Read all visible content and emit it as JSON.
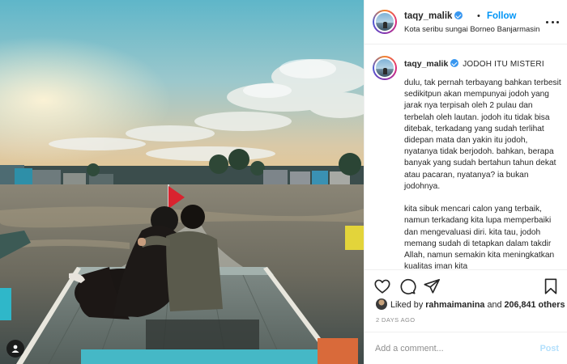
{
  "post": {
    "username": "taqy_malik",
    "follow_label": "Follow",
    "separator": "•",
    "location": "Kota seribu sungai Borneo Banjarmasin",
    "caption_title": "JODOH ITU MISTERI",
    "caption_body": "dulu, tak pernah terbayang bahkan terbesit sedikitpun akan mempunyai jodoh yang jarak nya terpisah oleh 2 pulau dan terbelah oleh lautan. jodoh itu tidak bisa ditebak, terkadang yang sudah terlihat didepan mata dan yakin itu jodoh, nyatanya tidak berjodoh. bahkan, berapa banyak yang sudah bertahun tahun dekat atau pacaran, nyatanya? ia bukan jodohnya.\n\nkita sibuk mencari calon yang terbaik, namun terkadang kita lupa memperbaiki dan mengevaluasi diri. kita tau, jodoh memang sudah di tetapkan dalam takdir Allah, namun semakin kita meningkatkan kualitas iman kita",
    "likes": {
      "prefix": "Liked by",
      "liker": "rahmaimanina",
      "connector": "and",
      "count": "206,841 others"
    },
    "date": "2 DAYS AGO"
  },
  "comment": {
    "placeholder": "Add a comment...",
    "post_label": "Post"
  },
  "icons": {
    "like": "heart-icon",
    "comment": "comment-bubble-icon",
    "share": "paper-plane-icon",
    "save": "bookmark-icon",
    "more": "more-dots-icon",
    "verified": "verified-badge-icon",
    "user_tag": "user-tag-icon"
  },
  "colors": {
    "accent": "#0095f6",
    "verified": "#3897f0",
    "post_disabled": "#b2dffc",
    "muted_text": "#8e8e8e"
  }
}
